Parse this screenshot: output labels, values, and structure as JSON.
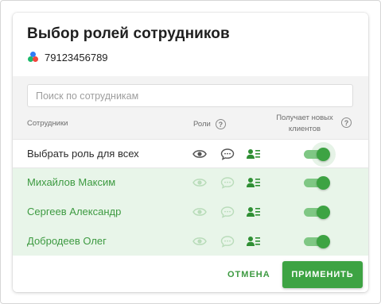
{
  "dialog": {
    "title": "Выбор ролей сотрудников",
    "phone": "79123456789"
  },
  "search": {
    "placeholder": "Поиск по сотрудникам",
    "value": ""
  },
  "table": {
    "col_employees": "Сотрудники",
    "col_roles": "Роли",
    "col_new_clients": "Получает новых клиентов"
  },
  "select_all": {
    "label": "Выбрать роль для всех",
    "receives_new_clients": true
  },
  "employees": [
    {
      "name": "Михайлов Максим",
      "receives_new_clients": true
    },
    {
      "name": "Сергеев Александр",
      "receives_new_clients": true
    },
    {
      "name": "Добродеев Олег",
      "receives_new_clients": true
    }
  ],
  "icons": {
    "roles": [
      "eye-icon",
      "chat-icon",
      "user-list-icon"
    ],
    "help": "help-icon",
    "brand": "colored-dots-icon"
  },
  "footer": {
    "cancel_label": "ОТМЕНА",
    "apply_label": "ПРИМЕНИТЬ"
  },
  "colors": {
    "accent": "#3da343",
    "row_selected_bg": "#e8f5e9",
    "header_bg": "#f3f3f3"
  }
}
